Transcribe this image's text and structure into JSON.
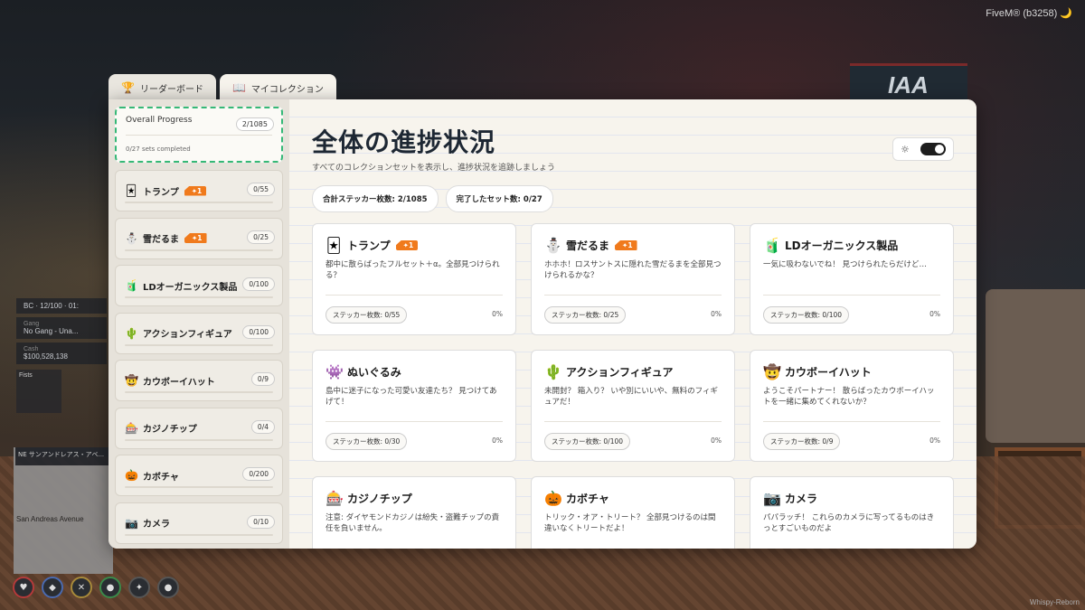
{
  "server_tag": "FiveM® (b3258) 🌙",
  "watermark": "Whispy-Reborn",
  "background_sign": "IAA",
  "hud": {
    "row1": [
      "BC",
      "12/100"
    ],
    "row2_time": "01:",
    "gang": "Gang",
    "gang_value": "No Gang - Una...",
    "cash_label": "Cash",
    "cash_value": "$100,528,138",
    "fists": "Fists",
    "location_dir": "NE",
    "location": "サンアンドレアス・アベ...",
    "street": "San Andreas Avenue"
  },
  "tabs": [
    {
      "label": "リーダーボード",
      "icon": "trophy-icon"
    },
    {
      "label": "マイコレクション",
      "icon": "book-icon"
    }
  ],
  "overall": {
    "label": "Overall Progress",
    "count": "2/1085",
    "sub": "0/27 sets completed"
  },
  "sidebar_items": [
    {
      "emoji": "🃏",
      "name": "トランプ",
      "badge": "1",
      "count": "0/55"
    },
    {
      "emoji": "⛄",
      "name": "雪だるま",
      "badge": "1",
      "count": "0/25"
    },
    {
      "emoji": "🧃",
      "name": "LDオーガニックス製品",
      "badge": "",
      "count": "0/100"
    },
    {
      "emoji": "🌵",
      "name": "アクションフィギュア",
      "badge": "",
      "count": "0/100"
    },
    {
      "emoji": "🤠",
      "name": "カウボーイハット",
      "badge": "",
      "count": "0/9"
    },
    {
      "emoji": "🎰",
      "name": "カジノチップ",
      "badge": "",
      "count": "0/4"
    },
    {
      "emoji": "🎃",
      "name": "カボチャ",
      "badge": "",
      "count": "0/200"
    },
    {
      "emoji": "📷",
      "name": "カメラ",
      "badge": "",
      "count": "0/10"
    }
  ],
  "main": {
    "title": "全体の進捗状況",
    "subtitle": "すべてのコレクションセットを表示し、進捗状況を追跡しましょう",
    "stat_total": "合計ステッカー枚数: 2/1085",
    "stat_sets": "完了したセット数: 0/27"
  },
  "cards": [
    {
      "emoji": "🃏",
      "name": "トランプ",
      "badge": "1",
      "desc": "都中に散らばったフルセット＋α。全部見つけられる？",
      "stickers": "ステッカー枚数: 0/55",
      "pct": "0%"
    },
    {
      "emoji": "⛄",
      "name": "雪だるま",
      "badge": "1",
      "desc": "ホホホ！ロスサントスに隠れた雪だるまを全部見つけられるかな？",
      "stickers": "ステッカー枚数: 0/25",
      "pct": "0%"
    },
    {
      "emoji": "🧃",
      "name": "LDオーガニックス製品",
      "badge": "",
      "desc": "一気に吸わないでね！ 見つけられたらだけど…",
      "stickers": "ステッカー枚数: 0/100",
      "pct": "0%"
    },
    {
      "emoji": "👾",
      "name": "ぬいぐるみ",
      "badge": "",
      "desc": "島中に迷子になった可愛い友達たち？ 見つけてあげて！",
      "stickers": "ステッカー枚数: 0/30",
      "pct": "0%"
    },
    {
      "emoji": "🌵",
      "name": "アクションフィギュア",
      "badge": "",
      "desc": "未開封？ 箱入り？ いや別にいいや、無料のフィギュアだ！",
      "stickers": "ステッカー枚数: 0/100",
      "pct": "0%"
    },
    {
      "emoji": "🤠",
      "name": "カウボーイハット",
      "badge": "",
      "desc": "ようこそパートナー！ 散らばったカウボーイハットを一緒に集めてくれないか？",
      "stickers": "ステッカー枚数: 0/9",
      "pct": "0%"
    },
    {
      "emoji": "🎰",
      "name": "カジノチップ",
      "badge": "",
      "desc": "注意: ダイヤモンドカジノは紛失・盗難チップの責任を負いません。",
      "stickers": "",
      "pct": ""
    },
    {
      "emoji": "🎃",
      "name": "カボチャ",
      "badge": "",
      "desc": "トリック・オア・トリート？ 全部見つけるのは間違いなくトリートだよ！",
      "stickers": "",
      "pct": ""
    },
    {
      "emoji": "📷",
      "name": "カメラ",
      "badge": "",
      "desc": "パパラッチ！ これらのカメラに写ってるものはきっとすごいものだよ",
      "stickers": "",
      "pct": ""
    }
  ]
}
